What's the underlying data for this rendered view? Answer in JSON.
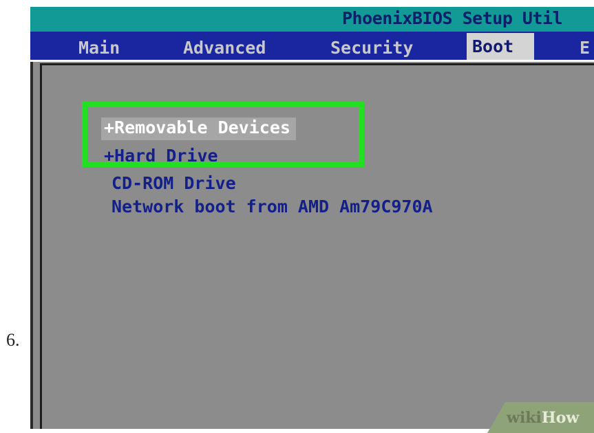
{
  "step_number": "6.",
  "bios": {
    "title": "PhoenixBIOS Setup Util",
    "tabs": [
      {
        "label": "Main",
        "active": false
      },
      {
        "label": "Advanced",
        "active": false
      },
      {
        "label": "Security",
        "active": false
      },
      {
        "label": "Boot",
        "active": true
      },
      {
        "label": "E",
        "active": false
      }
    ],
    "boot_items": [
      {
        "label": "+Removable Devices",
        "selected": true
      },
      {
        "label": "+Hard Drive",
        "selected": false
      },
      {
        "label": "CD-ROM Drive",
        "selected": false
      },
      {
        "label": "Network boot from AMD Am79C970A",
        "selected": false
      }
    ]
  },
  "watermark": {
    "part1": "wiki",
    "part2": "How"
  },
  "colors": {
    "title_bar": "#119a96",
    "menu_bar": "#1a26a0",
    "panel": "#8c8c8c",
    "highlight": "#22e021",
    "boot_text": "#14208a"
  }
}
